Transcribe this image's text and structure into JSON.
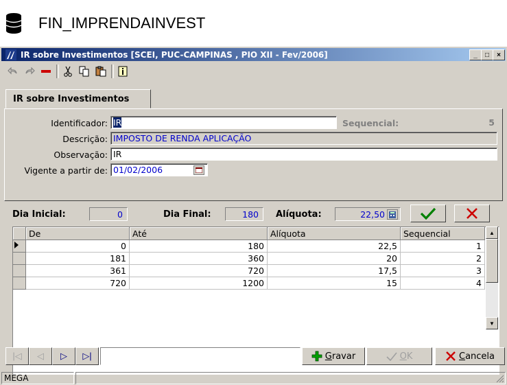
{
  "doc_title": "FIN_IMPRENDAINVEST",
  "window": {
    "title": "IR sobre Investimentos [SCEI, PUC-CAMPINAS , PIO XII - Fev/2006]",
    "minimize": "_",
    "maximize": "□",
    "close": "×"
  },
  "toolbar": {
    "icons": [
      "undo-icon",
      "redo-icon",
      "delete-icon",
      "cut-icon",
      "copy-icon",
      "paste-icon",
      "info-icon"
    ]
  },
  "tab": {
    "label": "IR sobre Investimentos"
  },
  "form": {
    "identificador_label": "Identificador:",
    "identificador_value": "IR",
    "sequencial_label": "Sequencial:",
    "sequencial_value": "5",
    "descricao_label": "Descrição:",
    "descricao_value": "IMPOSTO DE RENDA APLICAÇÃO",
    "observacao_label": "Observação:",
    "observacao_value": "IR",
    "vigente_label": "Vigente a partir de:",
    "vigente_value": "01/02/2006"
  },
  "rate": {
    "dia_inicial_label": "Dia Inicial:",
    "dia_inicial_value": "0",
    "dia_final_label": "Dia Final:",
    "dia_final_value": "180",
    "aliquota_label": "Alíquota:",
    "aliquota_value": "22,50"
  },
  "grid": {
    "columns": [
      "De",
      "Até",
      "Alíquota",
      "Sequencial"
    ],
    "rows": [
      [
        "0",
        "180",
        "22,5",
        "1"
      ],
      [
        "181",
        "360",
        "20",
        "2"
      ],
      [
        "361",
        "720",
        "17,5",
        "3"
      ],
      [
        "720",
        "1200",
        "15",
        "4"
      ]
    ]
  },
  "nav": {
    "first": "|◁",
    "prev": "◁",
    "next": "▷",
    "last": "▷|"
  },
  "actions": {
    "gravar_u": "G",
    "gravar_rest": "ravar",
    "ok_u": "O",
    "ok_rest": "K",
    "cancela_u": "C",
    "cancela_rest": "ancela"
  },
  "status": {
    "left": "MEGA"
  },
  "colors": {
    "titlebar_start": "#0a246a",
    "titlebar_end": "#a6caf0",
    "field_blue": "#0000cc",
    "face": "#d4d0c8"
  }
}
